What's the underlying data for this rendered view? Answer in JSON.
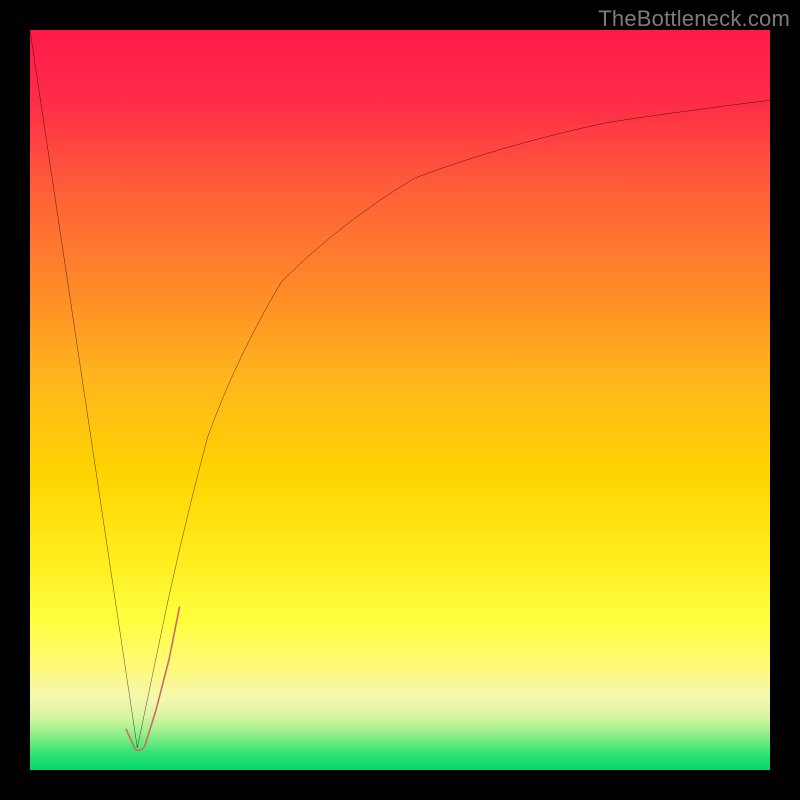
{
  "watermark": "TheBottleneck.com",
  "colors": {
    "frame": "#000000",
    "curve_black": "#000000",
    "curve_salmon": "#cf6a63",
    "grad_top": "#ff1a4a",
    "grad_mid_upper": "#ff7a2a",
    "grad_mid": "#ffd400",
    "grad_mid_lower": "#ffff40",
    "grad_pastel_band": "#fff7a8",
    "grad_green_top": "#8cf08c",
    "grad_green": "#1fe86f",
    "grad_bottom": "#00d86a"
  },
  "chart_data": {
    "type": "line",
    "title": "",
    "xlabel": "",
    "ylabel": "",
    "xlim": [
      0,
      100
    ],
    "ylim": [
      0,
      100
    ],
    "series": [
      {
        "name": "black-descend",
        "x": [
          0,
          14.5
        ],
        "y": [
          100,
          3
        ]
      },
      {
        "name": "black-ascend",
        "x": [
          14.5,
          17,
          20,
          24,
          28,
          34,
          42,
          52,
          64,
          78,
          90,
          100
        ],
        "y": [
          3,
          15,
          30,
          45,
          56,
          66,
          74,
          80,
          84.5,
          87.5,
          89.3,
          90.5
        ]
      },
      {
        "name": "salmon-tick",
        "x": [
          13,
          14.2,
          15.5,
          17,
          18.8,
          20.2
        ],
        "y": [
          5.5,
          2.8,
          3.2,
          8,
          15,
          22
        ]
      }
    ],
    "annotations": [
      {
        "text": "TheBottleneck.com",
        "pos": "top-right"
      }
    ]
  }
}
